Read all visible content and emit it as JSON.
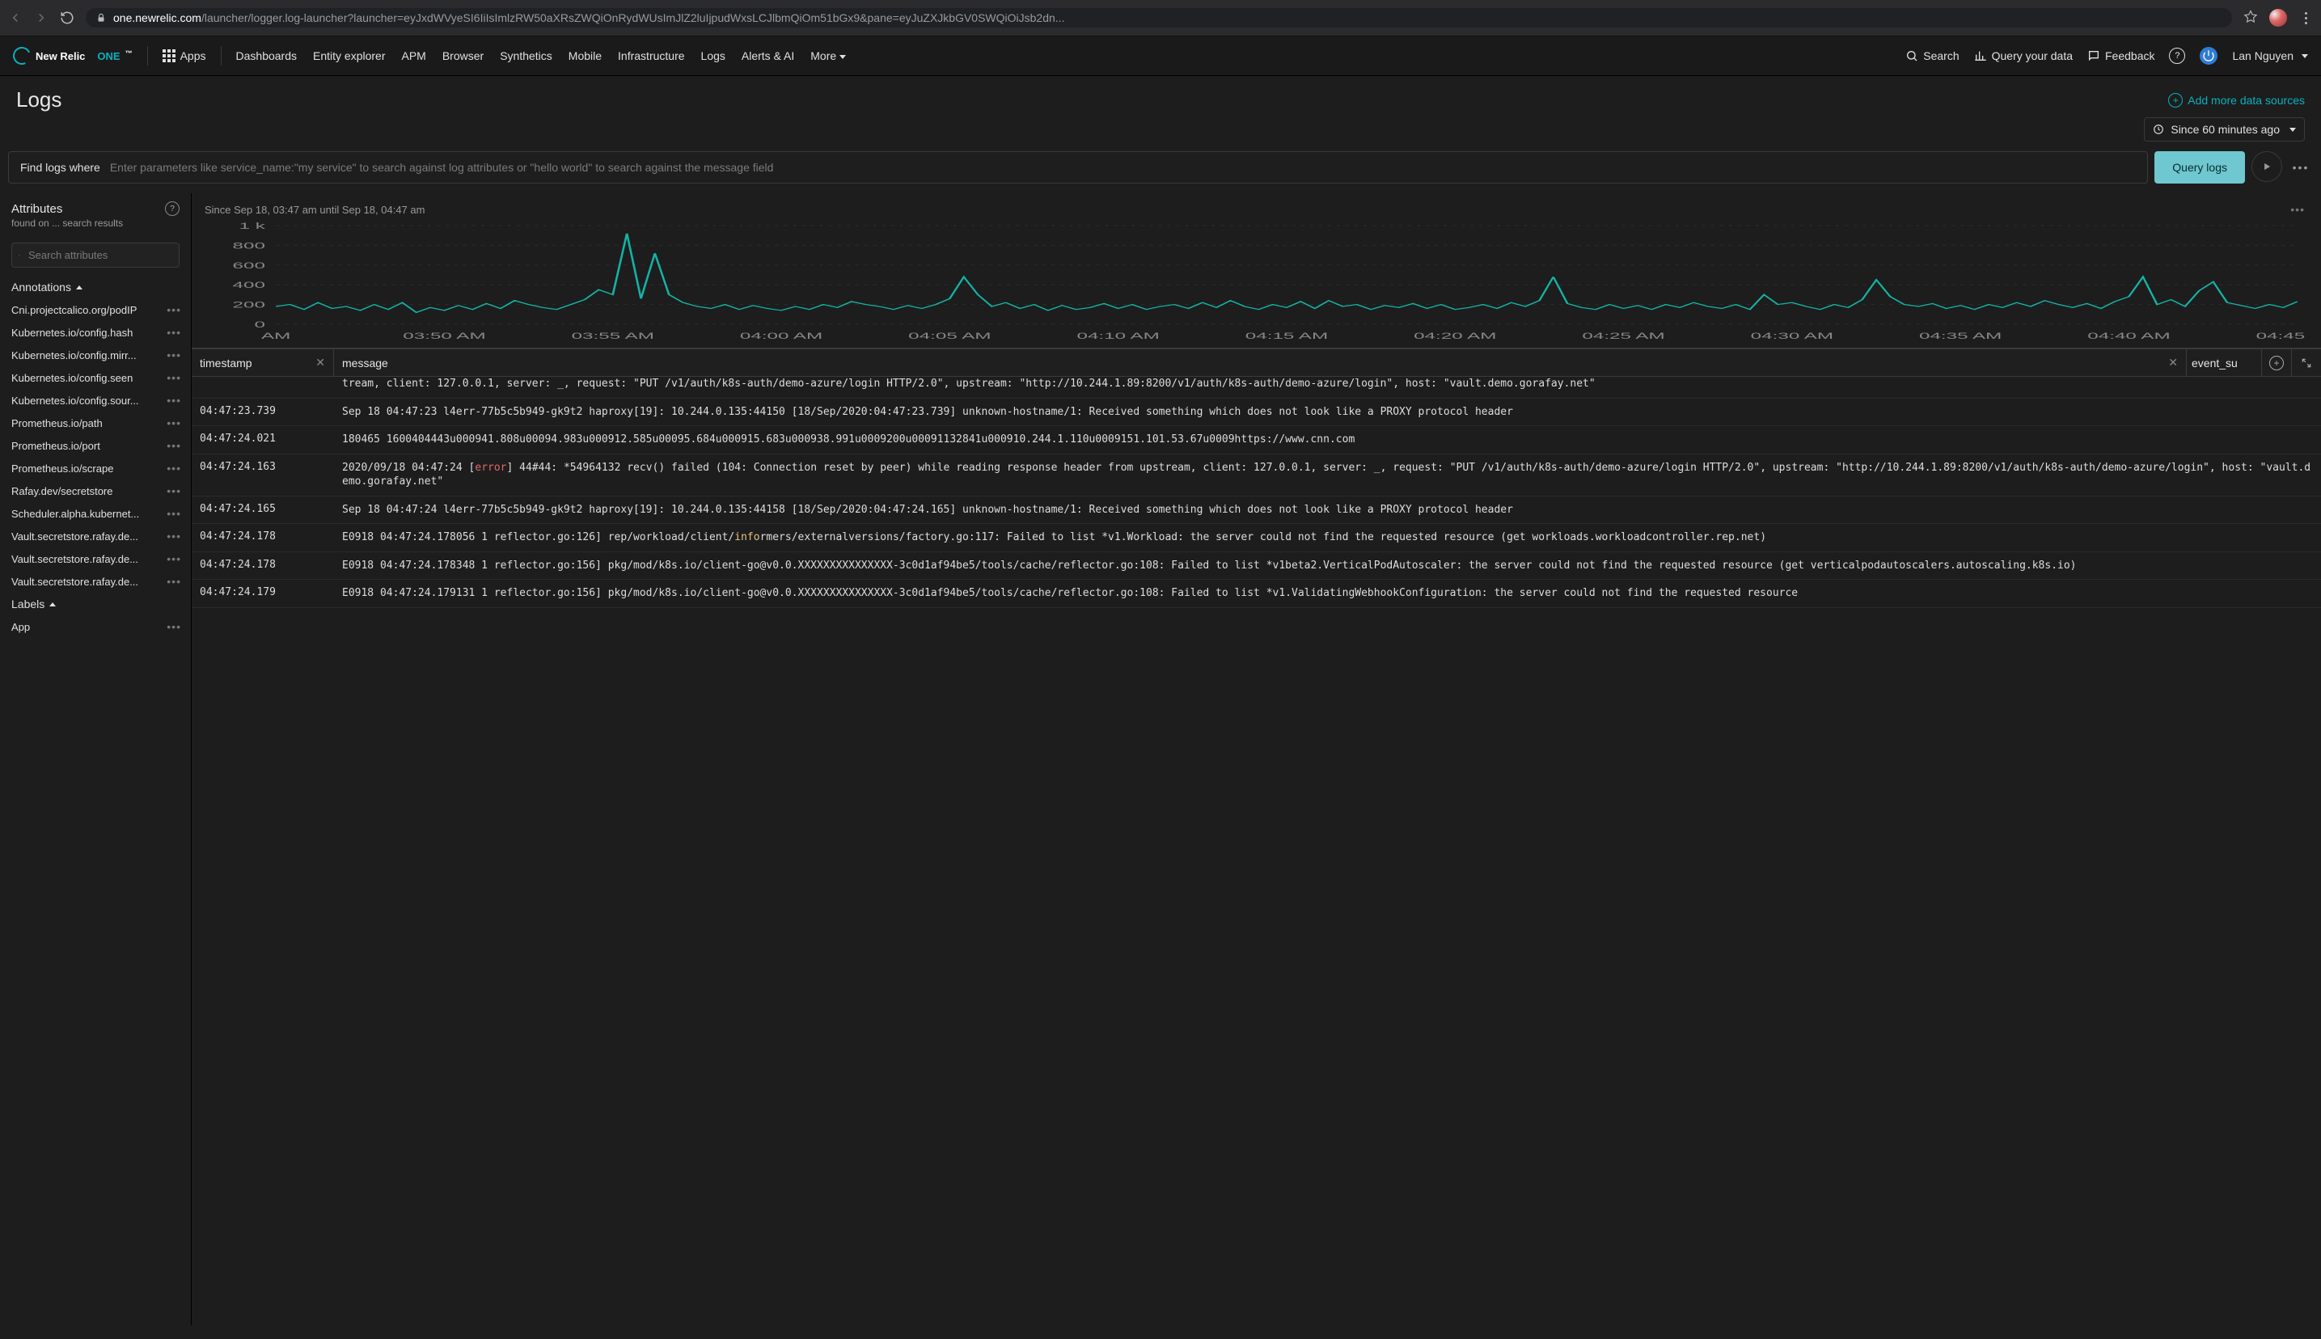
{
  "browser": {
    "host": "one.newrelic.com",
    "path": "/launcher/logger.log-launcher?launcher=eyJxdWVyeSI6IiIsImlzRW50aXRsZWQiOnRydWUsImJlZ2luIjpudWxsLCJlbmQiOm51bGx9&pane=eyJuZXJkbGV0SWQiOiJsb2dn..."
  },
  "nav": {
    "brand_a": "New Relic",
    "brand_b": "ONE",
    "tm": "™",
    "apps": "Apps",
    "items": [
      "Dashboards",
      "Entity explorer",
      "APM",
      "Browser",
      "Synthetics",
      "Mobile",
      "Infrastructure",
      "Logs",
      "Alerts & AI",
      "More"
    ],
    "search": "Search",
    "query_data": "Query your data",
    "feedback": "Feedback",
    "user": "Lan Nguyen"
  },
  "page": {
    "title": "Logs",
    "add_sources": "Add more data sources",
    "timerange": "Since 60 minutes ago"
  },
  "query": {
    "label": "Find logs where",
    "placeholder": "Enter parameters like service_name:\"my service\" to search against log attributes or \"hello world\" to search against the message field",
    "button": "Query logs"
  },
  "sidebar": {
    "attributes_title": "Attributes",
    "found_on_prefix": "found on",
    "found_on_dots": "...",
    "found_on_suffix": "search results",
    "search_placeholder": "Search attributes",
    "section_annotations": "Annotations",
    "annotations": [
      "Cni.projectcalico.org/podIP",
      "Kubernetes.io/config.hash",
      "Kubernetes.io/config.mirr...",
      "Kubernetes.io/config.seen",
      "Kubernetes.io/config.sour...",
      "Prometheus.io/path",
      "Prometheus.io/port",
      "Prometheus.io/scrape",
      "Rafay.dev/secretstore",
      "Scheduler.alpha.kubernet...",
      "Vault.secretstore.rafay.de...",
      "Vault.secretstore.rafay.de...",
      "Vault.secretstore.rafay.de..."
    ],
    "section_labels": "Labels",
    "labels": [
      "App"
    ]
  },
  "chart": {
    "range_label": "Since Sep 18, 03:47 am until Sep 18, 04:47 am"
  },
  "chart_data": {
    "type": "line",
    "title": "",
    "xlabel": "",
    "ylabel": "",
    "ylim": [
      0,
      1000
    ],
    "yticks": [
      0,
      200,
      400,
      600,
      800,
      1000
    ],
    "ytick_labels": [
      "0",
      "200",
      "400",
      "600",
      "800",
      "1 k"
    ],
    "categories": [
      "AM",
      "03:50 AM",
      "03:55 AM",
      "04:00 AM",
      "04:05 AM",
      "04:10 AM",
      "04:15 AM",
      "04:20 AM",
      "04:25 AM",
      "04:30 AM",
      "04:35 AM",
      "04:40 AM",
      "04:45 AM"
    ],
    "values": [
      180,
      200,
      150,
      220,
      160,
      180,
      140,
      200,
      150,
      220,
      120,
      170,
      140,
      190,
      150,
      210,
      160,
      240,
      200,
      170,
      150,
      200,
      250,
      350,
      300,
      920,
      260,
      720,
      300,
      220,
      180,
      160,
      200,
      150,
      190,
      160,
      140,
      180,
      150,
      200,
      170,
      230,
      200,
      180,
      150,
      190,
      160,
      200,
      260,
      480,
      300,
      180,
      220,
      160,
      200,
      140,
      190,
      150,
      170,
      210,
      160,
      200,
      150,
      180,
      200,
      160,
      220,
      170,
      240,
      180,
      150,
      200,
      170,
      230,
      160,
      240,
      180,
      200,
      150,
      190,
      170,
      210,
      160,
      200,
      150,
      170,
      200,
      160,
      220,
      180,
      240,
      480,
      210,
      170,
      150,
      200,
      160,
      190,
      150,
      200,
      170,
      220,
      180,
      160,
      200,
      150,
      300,
      200,
      220,
      180,
      150,
      200,
      170,
      250,
      450,
      280,
      200,
      180,
      210,
      160,
      190,
      150,
      200,
      170,
      220,
      180,
      240,
      200,
      170,
      210,
      160,
      230,
      280,
      480,
      200,
      250,
      180,
      340,
      430,
      220,
      190,
      160,
      200,
      170,
      230
    ]
  },
  "table": {
    "col_timestamp": "timestamp",
    "col_message": "message",
    "col_extra": "event_su",
    "rows": [
      {
        "ts": "",
        "cutoff": true,
        "msg_parts": [
          {
            "t": "tream, client: 127.0.0.1, server: _, request: \"PUT /v1/auth/k8s-auth/demo-azure/login HTTP/2.0\", upstream: \"http://10.244.1.89:8200/v1/auth/k8s-auth/demo-azure/login\", host: \"vault.demo.gorafay.net\""
          }
        ]
      },
      {
        "ts": "04:47:23.739",
        "msg_parts": [
          {
            "t": "Sep 18 04:47:23 l4err-77b5c5b949-gk9t2 haproxy[19]: 10.244.0.135:44150 [18/Sep/2020:04:47:23.739] unknown-hostname/1: Received something which does not look like a PROXY protocol header"
          }
        ]
      },
      {
        "ts": "04:47:24.021",
        "msg_parts": [
          {
            "t": "180465 1600404443u000941.808u00094.983u000912.585u00095.684u000915.683u000938.991u0009200u00091132841u000910.244.1.110u0009151.101.53.67u0009https://www.cnn.com"
          }
        ]
      },
      {
        "ts": "04:47:24.163",
        "msg_parts": [
          {
            "t": "2020/09/18 04:47:24 ["
          },
          {
            "t": "error",
            "cls": "err"
          },
          {
            "t": "] 44#44: *54964132 recv() failed (104: Connection reset by peer) while reading response header from upstream, client: 127.0.0.1, server: _, request: \"PUT /v1/auth/k8s-auth/demo-azure/login HTTP/2.0\", upstream: \"http://10.244.1.89:8200/v1/auth/k8s-auth/demo-azure/login\", host: \"vault.demo.gorafay.net\""
          }
        ]
      },
      {
        "ts": "04:47:24.165",
        "msg_parts": [
          {
            "t": "Sep 18 04:47:24 l4err-77b5c5b949-gk9t2 haproxy[19]: 10.244.0.135:44158 [18/Sep/2020:04:47:24.165] unknown-hostname/1: Received something which does not look like a PROXY protocol header"
          }
        ]
      },
      {
        "ts": "04:47:24.178",
        "msg_parts": [
          {
            "t": "E0918 04:47:24.178056 1 reflector.go:126] rep/workload/client/"
          },
          {
            "t": "info",
            "cls": "info"
          },
          {
            "t": "rmers/externalversions/factory.go:117: Failed to list *v1.Workload: the server could not find the requested resource (get workloads.workloadcontroller.rep.net)"
          }
        ]
      },
      {
        "ts": "04:47:24.178",
        "msg_parts": [
          {
            "t": "E0918 04:47:24.178348 1 reflector.go:156] pkg/mod/k8s.io/client-go@v0.0.XXXXXXXXXXXXXXX-3c0d1af94be5/tools/cache/reflector.go:108: Failed to list *v1beta2.VerticalPodAutoscaler: the server could not find the requested resource (get verticalpodautoscalers.autoscaling.k8s.io)"
          }
        ]
      },
      {
        "ts": "04:47:24.179",
        "msg_parts": [
          {
            "t": "E0918 04:47:24.179131 1 reflector.go:156] pkg/mod/k8s.io/client-go@v0.0.XXXXXXXXXXXXXXX-3c0d1af94be5/tools/cache/reflector.go:108: Failed to list *v1.ValidatingWebhookConfiguration: the server could not find the requested resource"
          }
        ]
      }
    ]
  }
}
